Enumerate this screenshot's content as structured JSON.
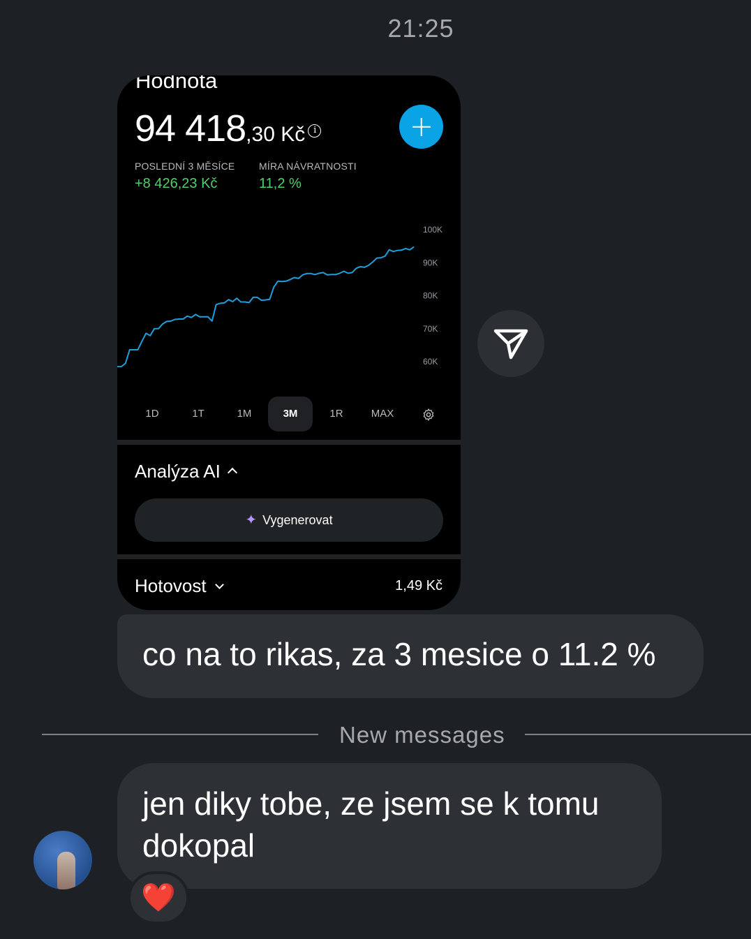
{
  "timestamp": "21:25",
  "shared_card": {
    "title": "Hodnota",
    "balance_main": "94 418",
    "balance_fraction": ",30 Kč",
    "info_icon": "info-icon",
    "add_icon": "plus-icon",
    "stats": [
      {
        "label": "POSLEDNÍ 3 MĚSÍCE",
        "value": "+8 426,23 Kč"
      },
      {
        "label": "MÍRA NÁVRATNOSTI",
        "value": "11,2 %"
      }
    ],
    "ranges": [
      "1D",
      "1T",
      "1M",
      "3M",
      "1R",
      "MAX"
    ],
    "active_range": "3M",
    "settings_icon": "gear-icon",
    "ai_section": "Analýza AI",
    "generate_button": "Vygenerovat",
    "cash_label": "Hotovost",
    "cash_value": "1,49 Kč",
    "accent_color": "#0aa3e6",
    "gain_color": "#4fd06b"
  },
  "chart_data": {
    "type": "line",
    "ytick_labels": [
      "100K",
      "90K",
      "80K",
      "70K",
      "60K"
    ],
    "ylim": [
      55000,
      105000
    ],
    "x": [
      0,
      1,
      2,
      3,
      4,
      5,
      6,
      7,
      8,
      9,
      10,
      11,
      12,
      13,
      14,
      15,
      16,
      17,
      18,
      19,
      20,
      21,
      22,
      23,
      24,
      25,
      26,
      27,
      28,
      29,
      30,
      31,
      32,
      33,
      34,
      35,
      36,
      37,
      38,
      39,
      40,
      41,
      42,
      43,
      44,
      45,
      46,
      47,
      48,
      49,
      50,
      51,
      52,
      53,
      54,
      55,
      56,
      57,
      58,
      59,
      60,
      61,
      62,
      63,
      64,
      65,
      66,
      67,
      68,
      69,
      70,
      71,
      72
    ],
    "series": [
      {
        "values": [
          58500,
          58500,
          59500,
          63600,
          63600,
          63600,
          66200,
          68600,
          67900,
          70000,
          70000,
          71400,
          72200,
          72300,
          72800,
          72900,
          72900,
          73800,
          73400,
          74300,
          73600,
          73600,
          73600,
          72300,
          77300,
          77700,
          77800,
          78800,
          78200,
          79200,
          78100,
          78100,
          77900,
          79500,
          79500,
          78600,
          78700,
          78900,
          82600,
          84400,
          84300,
          84400,
          84900,
          85500,
          85200,
          86300,
          86700,
          86700,
          86400,
          86800,
          87000,
          86300,
          86400,
          86400,
          86800,
          87400,
          86800,
          87000,
          88300,
          88800,
          88600,
          89200,
          90200,
          91400,
          91500,
          92000,
          93900,
          93400,
          93700,
          93800,
          94300,
          93900,
          94800
        ]
      }
    ],
    "line_color": "#1e9fdc"
  },
  "messages": [
    {
      "text": "co na to rikas, za 3 mesice o 11.2 %"
    },
    {
      "text": "jen diky tobe, ze jsem se k tomu dokopal",
      "reaction": "❤️"
    }
  ],
  "divider_text": "New messages",
  "share_icon": "send-icon",
  "avatar": "avatar"
}
